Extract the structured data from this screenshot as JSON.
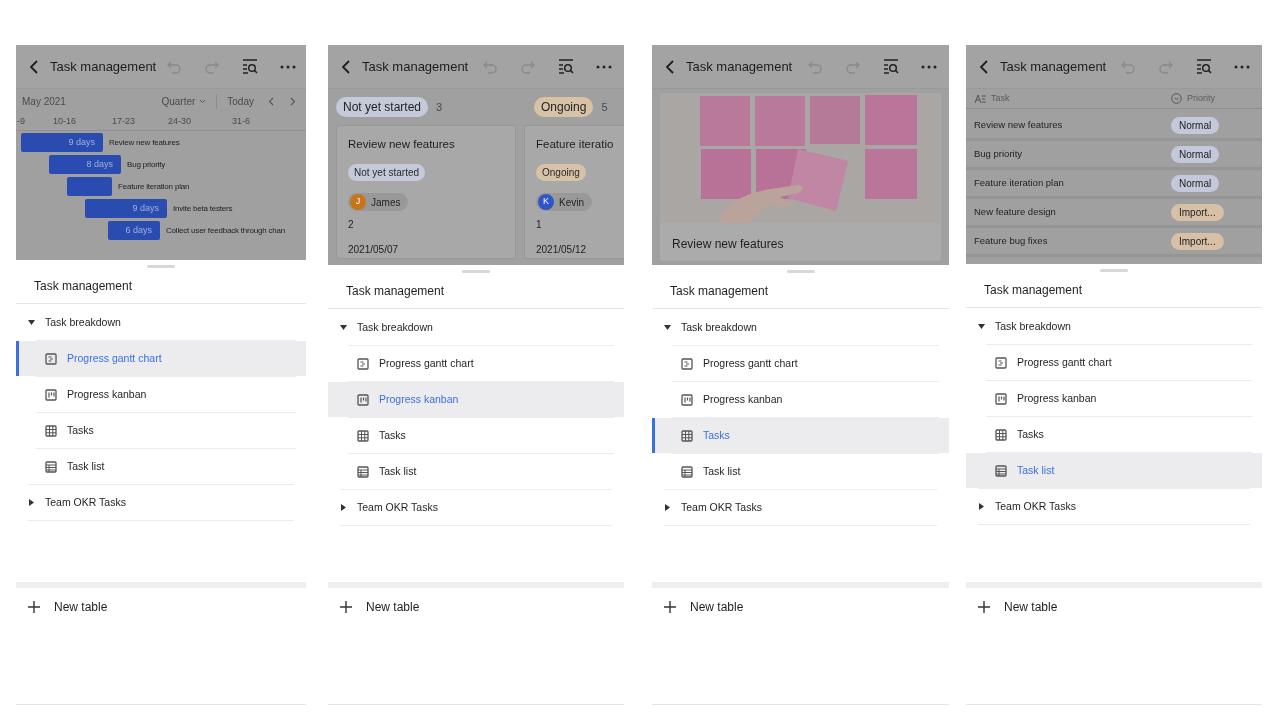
{
  "panels": [
    {
      "kind": "gantt",
      "title": "Task management",
      "gantt": {
        "month": "May 2021",
        "scale": "Quarter",
        "today": "Today",
        "weeks": [
          "-9",
          "10-16",
          "17-23",
          "24-30",
          "31-6"
        ],
        "bars": [
          {
            "duration": "9 days",
            "label": "Review new features"
          },
          {
            "duration": "8 days",
            "label": "Bug priority"
          },
          {
            "label": "Feature iteration plan"
          },
          {
            "duration": "9 days",
            "label": "Invite beta testers"
          },
          {
            "duration": "6 days",
            "label": "Collect user feedback through chan"
          }
        ]
      },
      "sheet": {
        "title": "Task management",
        "selection_bar": true,
        "new_table": "New table",
        "groups": [
          {
            "label": "Task breakdown",
            "expanded": true,
            "children": [
              {
                "label": "Progress gantt chart",
                "kind": "gantt",
                "selected": true
              },
              {
                "label": "Progress kanban",
                "kind": "kanban",
                "selected": false
              },
              {
                "label": "Tasks",
                "kind": "grid",
                "selected": false
              },
              {
                "label": "Task list",
                "kind": "list",
                "selected": false
              }
            ]
          },
          {
            "label": "Team OKR Tasks",
            "expanded": false
          }
        ]
      }
    },
    {
      "kind": "kanban",
      "title": "Task management",
      "kanban": {
        "columns": [
          {
            "title": "Not yet started",
            "count": "3",
            "color": "#c5cadb",
            "card": {
              "title": "Review new features",
              "status": "Not yet started",
              "assignee": {
                "initial": "J",
                "name": "James",
                "color": "#c8741a"
              },
              "number": "2",
              "date": "2021/05/07"
            }
          },
          {
            "title": "Ongoing",
            "count": "5",
            "color": "#d7c2a8",
            "card": {
              "title": "Feature iteratio",
              "status": "Ongoing",
              "assignee": {
                "initial": "K",
                "name": "Kevin",
                "color": "#2f55c8"
              },
              "number": "1",
              "date": "2021/05/12"
            }
          }
        ]
      },
      "sheet": {
        "title": "Task management",
        "selection_bar": false,
        "new_table": "New table",
        "groups": [
          {
            "label": "Task breakdown",
            "expanded": true,
            "children": [
              {
                "label": "Progress gantt chart",
                "kind": "gantt",
                "selected": false
              },
              {
                "label": "Progress kanban",
                "kind": "kanban",
                "selected": true
              },
              {
                "label": "Tasks",
                "kind": "grid",
                "selected": false
              },
              {
                "label": "Task list",
                "kind": "list",
                "selected": false
              }
            ]
          },
          {
            "label": "Team OKR Tasks",
            "expanded": false
          }
        ]
      }
    },
    {
      "kind": "gallery",
      "title": "Task management",
      "gallery": {
        "card_title": "Review new features"
      },
      "sheet": {
        "title": "Task management",
        "selection_bar": true,
        "new_table": "New table",
        "groups": [
          {
            "label": "Task breakdown",
            "expanded": true,
            "children": [
              {
                "label": "Progress gantt chart",
                "kind": "gantt",
                "selected": false
              },
              {
                "label": "Progress kanban",
                "kind": "kanban",
                "selected": false
              },
              {
                "label": "Tasks",
                "kind": "grid",
                "selected": true
              },
              {
                "label": "Task list",
                "kind": "list",
                "selected": false
              }
            ]
          },
          {
            "label": "Team OKR Tasks",
            "expanded": false
          }
        ]
      }
    },
    {
      "kind": "grid",
      "title": "Task management",
      "grid": {
        "columns": [
          "Task",
          "Priority"
        ],
        "rows": [
          {
            "task": "Review new features",
            "priority": "Normal",
            "color": "#c3c9da"
          },
          {
            "task": "Bug priority",
            "priority": "Normal",
            "color": "#c3c9da"
          },
          {
            "task": "Feature iteration plan",
            "priority": "Normal",
            "color": "#c3c9da"
          },
          {
            "task": "New feature design",
            "priority": "Import...",
            "color": "#d8c0a6"
          },
          {
            "task": "Feature bug fixes",
            "priority": "Import...",
            "color": "#d8c0a6"
          }
        ]
      },
      "sheet": {
        "title": "Task management",
        "selection_bar": false,
        "new_table": "New table",
        "groups": [
          {
            "label": "Task breakdown",
            "expanded": true,
            "children": [
              {
                "label": "Progress gantt chart",
                "kind": "gantt",
                "selected": false
              },
              {
                "label": "Progress kanban",
                "kind": "kanban",
                "selected": false
              },
              {
                "label": "Tasks",
                "kind": "grid",
                "selected": false
              },
              {
                "label": "Task list",
                "kind": "list",
                "selected": true
              }
            ]
          },
          {
            "label": "Team OKR Tasks",
            "expanded": false
          }
        ]
      }
    }
  ]
}
